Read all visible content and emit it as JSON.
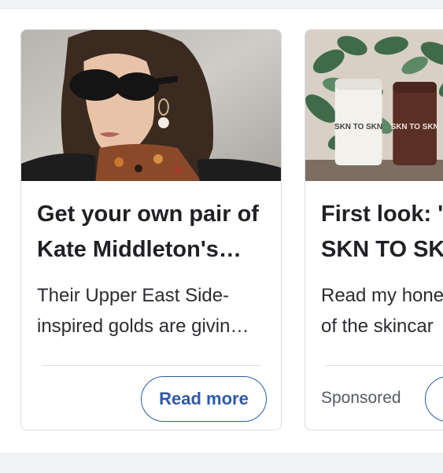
{
  "cards": [
    {
      "title": "Get your own pair of\nKate Middleton's…",
      "description": "Their Upper East Side-\ninspired golds are givin…",
      "button_label": "Read more",
      "image_icon": "woman-sunglasses-photo"
    },
    {
      "title": "First look: '\nSKN TO SK",
      "description": "Read my hone\nof the skincar",
      "sponsored_label": "Sponsored",
      "image_icon": "skincare-products-photo",
      "product_labels": [
        "SKN TO SKN",
        "SKN TO SKN"
      ]
    }
  ],
  "colors": {
    "accent": "#2e5aa8",
    "card_border": "#dcdee3",
    "page_band": "#f2f3f5"
  }
}
